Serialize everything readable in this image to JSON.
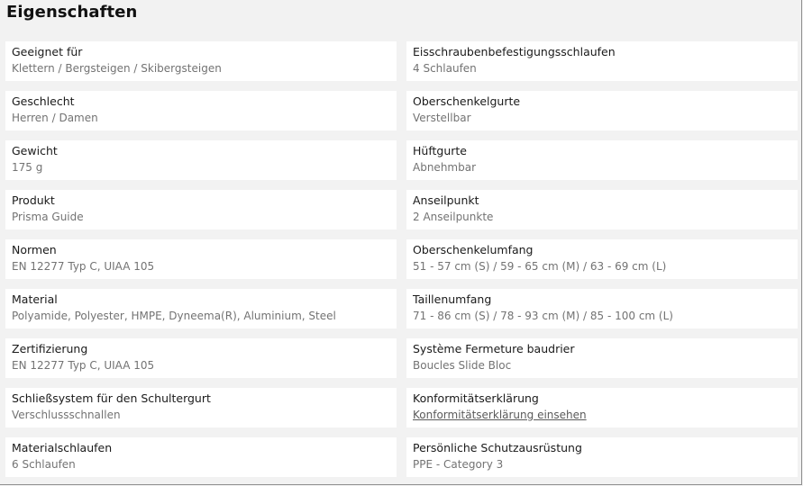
{
  "title": "Eigenschaften",
  "left": [
    {
      "label": "Geeignet für",
      "value": "Klettern / Bergsteigen / Skibergsteigen"
    },
    {
      "label": "Geschlecht",
      "value": "Herren / Damen"
    },
    {
      "label": "Gewicht",
      "value": "175 g"
    },
    {
      "label": "Produkt",
      "value": "Prisma Guide"
    },
    {
      "label": "Normen",
      "value": "EN 12277 Typ C, UIAA 105"
    },
    {
      "label": "Material",
      "value": "Polyamide, Polyester, HMPE, Dyneema(R), Aluminium, Steel"
    },
    {
      "label": "Zertifizierung",
      "value": "EN 12277 Typ C, UIAA 105"
    },
    {
      "label": "Schließsystem für den Schultergurt",
      "value": "Verschlussschnallen"
    },
    {
      "label": "Materialschlaufen",
      "value": "6 Schlaufen"
    }
  ],
  "right": [
    {
      "label": "Eisschraubenbefestigungsschlaufen",
      "value": "4 Schlaufen"
    },
    {
      "label": "Oberschenkelgurte",
      "value": "Verstellbar"
    },
    {
      "label": "Hüftgurte",
      "value": "Abnehmbar"
    },
    {
      "label": "Anseilpunkt",
      "value": "2 Anseilpunkte"
    },
    {
      "label": "Oberschenkelumfang",
      "value": "51 - 57 cm (S) / 59 - 65 cm (M) / 63 - 69 cm (L)"
    },
    {
      "label": "Taillenumfang",
      "value": "71 - 86 cm (S) / 78 - 93 cm (M) / 85 - 100 cm (L)"
    },
    {
      "label": "Système Fermeture baudrier",
      "value": "Boucles Slide Bloc"
    },
    {
      "label": "Konformitätserklärung",
      "value": "Konformitätserklärung einsehen"
    },
    {
      "label": "Persönliche Schutzausrüstung",
      "value": "PPE - Category 3"
    }
  ]
}
